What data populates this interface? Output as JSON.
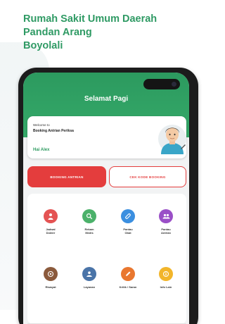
{
  "app": {
    "title_lines": [
      "Rumah Sakit Umum Daerah",
      "Pandan Arang",
      "Boyolali"
    ]
  },
  "header": {
    "greeting": "Selamat Pagi",
    "color": "#2c9a5f"
  },
  "welcome_card": {
    "line1": "Welcome to",
    "line2": "Booking Antrian Periksa",
    "user_name": "Hai Alex"
  },
  "actions": {
    "booking_label": "BOOKING ANTRIAN",
    "cek_label": "CEK KODE BOOKING",
    "accent": "#e43d3d"
  },
  "menu": [
    {
      "label_lines": [
        "Jadwal",
        "Dokter"
      ],
      "icon": "doctor-icon",
      "color": "#e45353"
    },
    {
      "label_lines": [
        "Rekam",
        "Medis"
      ],
      "icon": "search-icon",
      "color": "#4bb16a"
    },
    {
      "label_lines": [
        "Pantau",
        "Obat"
      ],
      "icon": "pill-icon",
      "color": "#3b8fe0"
    },
    {
      "label_lines": [
        "Pantau",
        "Antrian"
      ],
      "icon": "people-icon",
      "color": "#9a4fc7"
    },
    {
      "label_lines": [
        "Riwayat"
      ],
      "icon": "history-icon",
      "color": "#8b5a3c"
    },
    {
      "label_lines": [
        "Layanan"
      ],
      "icon": "service-icon",
      "color": "#4a74a8"
    },
    {
      "label_lines": [
        "Kritik / Saran"
      ],
      "icon": "feedback-icon",
      "color": "#e9772f"
    },
    {
      "label_lines": [
        "Info Lain"
      ],
      "icon": "info-icon",
      "color": "#f2b52a"
    }
  ]
}
